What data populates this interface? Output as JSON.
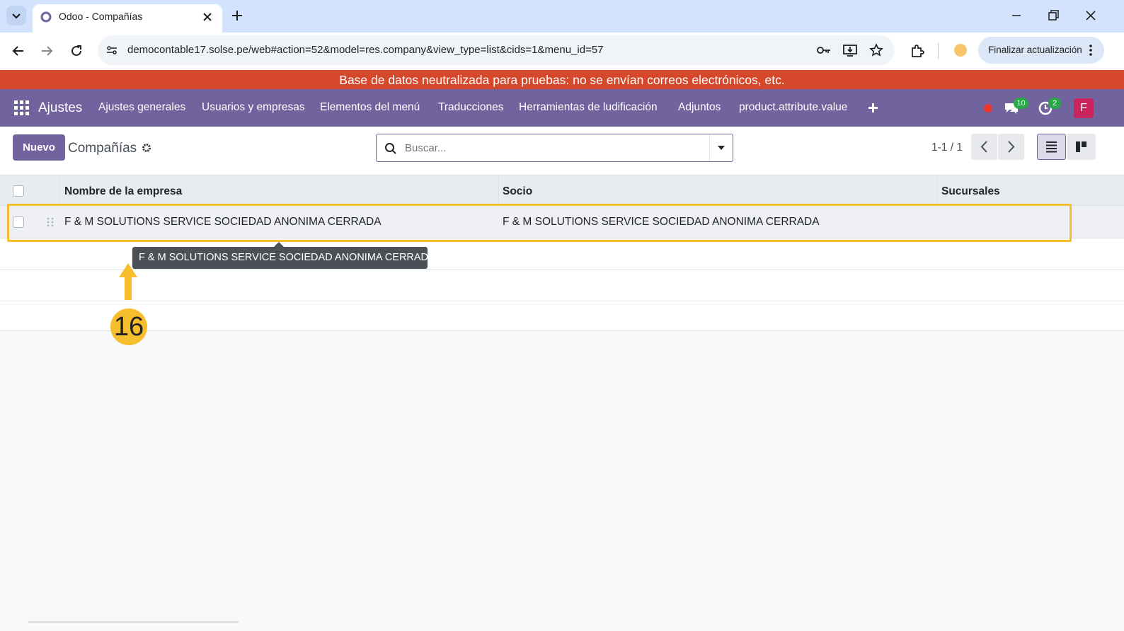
{
  "browser": {
    "tab_title": "Odoo - Compañías",
    "url": "democontable17.solse.pe/web#action=52&model=res.company&view_type=list&cids=1&menu_id=57",
    "update_label": "Finalizar actualización"
  },
  "banner": {
    "text": "Base de datos neutralizada para pruebas: no se envían correos electrónicos, etc."
  },
  "navbar": {
    "app_name": "Ajustes",
    "items": [
      {
        "label": "Ajustes generales"
      },
      {
        "label": "Usuarios y empresas"
      },
      {
        "label": "Elementos del menú"
      },
      {
        "label": "Traducciones"
      },
      {
        "label": "Herramientas de ludificación"
      },
      {
        "label": "Adjuntos"
      },
      {
        "label": "product.attribute.value"
      }
    ],
    "messages_count": "10",
    "activities_count": "2",
    "avatar_letter": "F"
  },
  "control_panel": {
    "new_label": "Nuevo",
    "title": "Compañías",
    "search_placeholder": "Buscar...",
    "pager": "1-1 / 1"
  },
  "list": {
    "columns": [
      "Nombre de la empresa",
      "Socio",
      "Sucursales"
    ],
    "rows": [
      {
        "name": "F & M SOLUTIONS SERVICE SOCIEDAD ANONIMA CERRADA",
        "partner": "F & M SOLUTIONS SERVICE SOCIEDAD ANONIMA CERRADA",
        "branches": ""
      }
    ]
  },
  "tooltip": {
    "text": "F & M SOLUTIONS SERVICE SOCIEDAD ANONIMA CERRADA"
  },
  "annotation": {
    "step": "16",
    "color": "#f6be2c"
  },
  "colors": {
    "brand": "#71639e",
    "banner": "#d5482b"
  }
}
